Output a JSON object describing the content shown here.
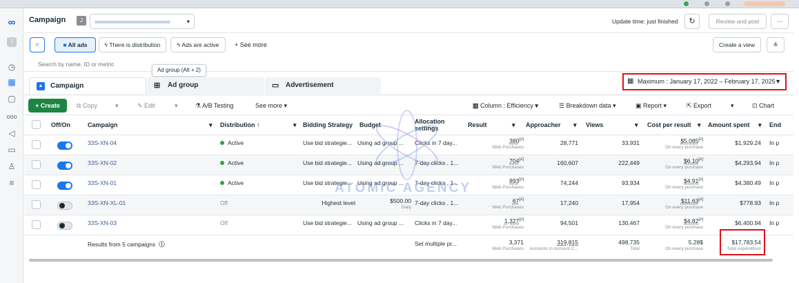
{
  "sidebar": {
    "items": [
      "meta-logo-icon",
      "account-icon",
      "clock-icon",
      "grid-icon",
      "pages-icon",
      "audience-icon",
      "megaphone-icon",
      "billing-icon",
      "people-icon",
      "menu-icon"
    ]
  },
  "header": {
    "title": "Campaign",
    "account_initial": "J",
    "update_time": "Update time: just finished",
    "review_label": "Review and post",
    "more_label": "···"
  },
  "filters": {
    "all_ads": "All ads",
    "chip1": "There is distribution",
    "chip2": "Ads are active",
    "see_more": "+ See more",
    "create_view": "Create a view",
    "search_placeholder": "Search by name, ID or metric",
    "tooltip": "Ad group (Alt + 2)"
  },
  "tabs": {
    "campaign": "Campaign",
    "ad_group": "Ad group",
    "advertisement": "Advertisement"
  },
  "date_range": "Maximum : January 17, 2022 – February 17, 2025",
  "toolbar": {
    "create": "+ Create",
    "copy": "Copy",
    "edit": "Edit",
    "ab": "A/B Testing",
    "see_more": "See more",
    "column": "Column : Efficiency",
    "breakdown": "Breakdown data",
    "report": "Report",
    "export": "Export",
    "chart": "Chart"
  },
  "columns": [
    "Off/On",
    "Campaign",
    "Distribution ↑",
    "Bidding Strategy",
    "Budget",
    "Allocation settings",
    "Result",
    "Approacher",
    "Views",
    "Cost per result",
    "Amount spent",
    "End"
  ],
  "rows": [
    {
      "name": "33S-XN-04",
      "status": "Active",
      "active": true,
      "on": true,
      "bidding": "Use bid strategie...",
      "budget": "Using ad group ...",
      "budget_sub": "",
      "alloc": "Clicks in 7 day...",
      "result": "380",
      "result_sup": "[2]",
      "result_sub": "Web Purchases",
      "approacher": "28,771",
      "views": "33,931",
      "cpr": "$5.085",
      "cpr_sup": "[2]",
      "cpr_sub": "On every purchase",
      "spent": "$1,929.24",
      "end": "In p"
    },
    {
      "name": "33S-XN-02",
      "status": "Active",
      "active": true,
      "on": true,
      "bidding": "Use bid strategie...",
      "budget": "Using ad group ...",
      "budget_sub": "",
      "alloc": "7-day clicks , 1...",
      "result": "704",
      "result_sup": "[2]",
      "result_sub": "Web Purchases",
      "approacher": "160,607",
      "views": "222,449",
      "cpr": "$6.10",
      "cpr_sup": "[2]",
      "cpr_sub": "On every purchase",
      "spent": "$4,293.94",
      "end": "In p"
    },
    {
      "name": "33S-XN-01",
      "status": "Active",
      "active": true,
      "on": true,
      "bidding": "Use bid strategie...",
      "budget": "Using ad group ...",
      "budget_sub": "",
      "alloc": "7-day clicks , 1...",
      "result": "893",
      "result_sup": "[2]",
      "result_sub": "Web Purchases",
      "approacher": "74,244",
      "views": "93,934",
      "cpr": "$4.91",
      "cpr_sup": "[2]",
      "cpr_sub": "On every purchase",
      "spent": "$4,380.49",
      "end": "In p"
    },
    {
      "name": "33S-XN-XL-01",
      "status": "Off",
      "active": false,
      "on": false,
      "bidding": "Highest level",
      "budget": "$500.00",
      "budget_sub": "Daily",
      "alloc": "7-day clicks , 1...",
      "result": "67",
      "result_sup": "[2]",
      "result_sub": "Web Purchases",
      "approacher": "17,240",
      "views": "17,954",
      "cpr": "$11.63",
      "cpr_sup": "[2]",
      "cpr_sub": "On every purchase",
      "spent": "$778.93",
      "end": "In p"
    },
    {
      "name": "33S-XN-03",
      "status": "Off",
      "active": false,
      "on": false,
      "bidding": "Use bid strategie...",
      "budget": "Using ad group ...",
      "budget_sub": "",
      "alloc": "Clicks in 7 day...",
      "result": "1,327",
      "result_sup": "[2]",
      "result_sub": "Web Purchases",
      "approacher": "94,501",
      "views": "130,467",
      "cpr": "$4.82",
      "cpr_sup": "[2]",
      "cpr_sub": "On every purchase",
      "spent": "$6,400.94",
      "end": "In p"
    }
  ],
  "totals": {
    "label": "Results from 5 campaigns",
    "alloc": "Set multiple pr...",
    "result": "3,371",
    "result_sub": "Web Purchases",
    "approacher": "319,815",
    "approacher_sub": "Accounts in Account C...",
    "views": "498,735",
    "views_sub": "Total",
    "cpr": "5.28$",
    "cpr_sub": "On every purchase",
    "spent": "$17,783.54",
    "spent_sub": "Total expenditure"
  },
  "watermark": "ATOMIC AGENCY",
  "colors": {
    "accent": "#1877f2",
    "create": "#1d8541",
    "highlight": "#e0101b",
    "active": "#31a24c"
  }
}
